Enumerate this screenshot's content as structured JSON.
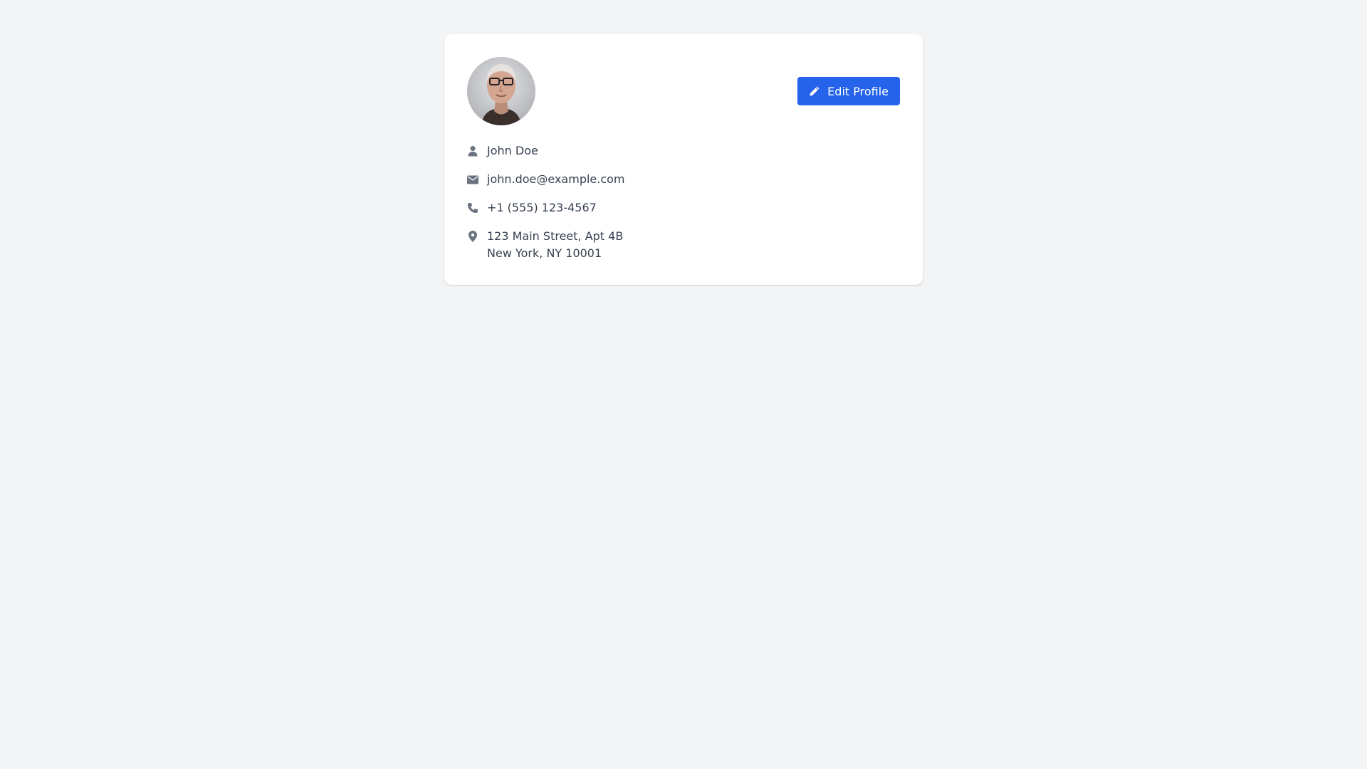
{
  "profile": {
    "name": "John Doe",
    "email": "john.doe@example.com",
    "phone": "+1 (555) 123-4567",
    "address_line1": "123 Main Street, Apt 4B",
    "address_line2": "New York, NY 10001"
  },
  "actions": {
    "edit_label": "Edit Profile"
  },
  "icons": {
    "edit": "pencil-icon",
    "name": "user-icon",
    "email": "envelope-icon",
    "phone": "phone-icon",
    "address": "map-pin-icon"
  },
  "colors": {
    "page_background": "#f3f4f6",
    "card_background": "#ffffff",
    "primary_button": "#2563eb",
    "text": "#374151",
    "icon": "#6b7280"
  }
}
